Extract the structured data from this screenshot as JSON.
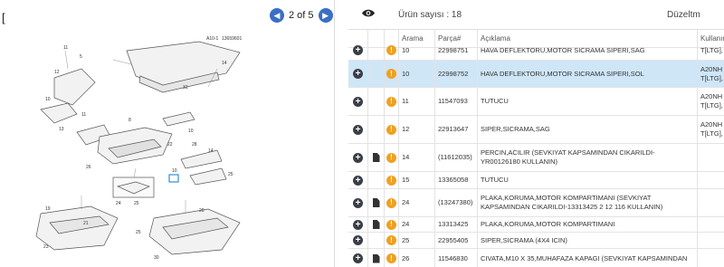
{
  "left_panel": {
    "bracket": "[",
    "pager_text": "2 of 5",
    "prev_icon": "chevron-left-icon",
    "next_icon": "chevron-right-icon",
    "diagram_callouts": [
      "11",
      "5",
      "12",
      "A10-1",
      "13659601",
      "14",
      "31",
      "10",
      "11",
      "26",
      "13",
      "8",
      "10",
      "22",
      "28",
      "14",
      "24",
      "25",
      "10",
      "25",
      "19",
      "21",
      "23",
      "25",
      "20",
      "30"
    ],
    "highlight_label": "10"
  },
  "right_panel": {
    "eye_icon": "eye-icon",
    "count_text": "Ürün sayısı : 18",
    "edit_text": "Düzeltm",
    "columns": [
      "Arama",
      "Parça#",
      "Açıklama",
      "Kullanım"
    ],
    "rows": [
      {
        "arama": "10",
        "parca": "22998751",
        "aciklama": [
          "HAVA DEFLEKTORU,MOTOR SICRAMA SIPERI,SAG"
        ],
        "kullanim": [
          "T[LTG],"
        ],
        "doc": false,
        "warn": true,
        "selected": false
      },
      {
        "arama": "10",
        "parca": "22998752",
        "aciklama": [
          "HAVA DEFLEKTORU,MOTOR SICRAMA SIPERI,SOL"
        ],
        "kullanim": [
          "A20NH",
          "T[LTG],"
        ],
        "doc": false,
        "warn": true,
        "selected": true
      },
      {
        "arama": "11",
        "parca": "11547093",
        "aciklama": [
          "TUTUCU"
        ],
        "kullanim": [
          "A20NH",
          "T[LTG],"
        ],
        "doc": false,
        "warn": true,
        "selected": false
      },
      {
        "arama": "12",
        "parca": "22913647",
        "aciklama": [
          "SIPER,SICRAMA,SAG"
        ],
        "kullanim": [
          "A20NH",
          "T[LTG],"
        ],
        "doc": false,
        "warn": true,
        "selected": false
      },
      {
        "arama": "14",
        "parca": "(11612035)",
        "aciklama": [
          "PERCIN,ACILIR (SEVKIYAT KAPSAMINDAN CIKARILDI-",
          "YR00126180 KULLANIN)"
        ],
        "kullanim": [],
        "doc": true,
        "warn": true,
        "selected": false
      },
      {
        "arama": "15",
        "parca": "13365058",
        "aciklama": [
          "TUTUCU"
        ],
        "kullanim": [],
        "doc": false,
        "warn": true,
        "selected": false
      },
      {
        "arama": "24",
        "parca": "(13247380)",
        "aciklama": [
          "PLAKA,KORUMA,MOTOR KOMPARTIMANI (SEVKIYAT",
          "KAPSAMINDAN CIKARILDI-13313425 2 12 116 KULLANIN)"
        ],
        "kullanim": [],
        "doc": true,
        "warn": true,
        "selected": false
      },
      {
        "arama": "24",
        "parca": "13313425",
        "aciklama": [
          "PLAKA,KORUMA,MOTOR KOMPARTIMANI"
        ],
        "kullanim": [],
        "doc": true,
        "warn": true,
        "selected": false
      },
      {
        "arama": "25",
        "parca": "22955405",
        "aciklama": [
          "SIPER,SICRAMA (4X4 ICIN)"
        ],
        "kullanim": [],
        "doc": false,
        "warn": true,
        "selected": false
      },
      {
        "arama": "26",
        "parca": "11546830",
        "aciklama": [
          "CIVATA,M10 X 35,MUHAFAZA KAPAGI (SEVKIYAT KAPSAMINDAN"
        ],
        "kullanim": [],
        "doc": true,
        "warn": true,
        "selected": false
      }
    ]
  },
  "colors": {
    "nav_blue": "#3a6fc4",
    "selected_row": "#cfe6f7",
    "warning": "#f0a020",
    "dark_icon": "#3a3f47"
  }
}
